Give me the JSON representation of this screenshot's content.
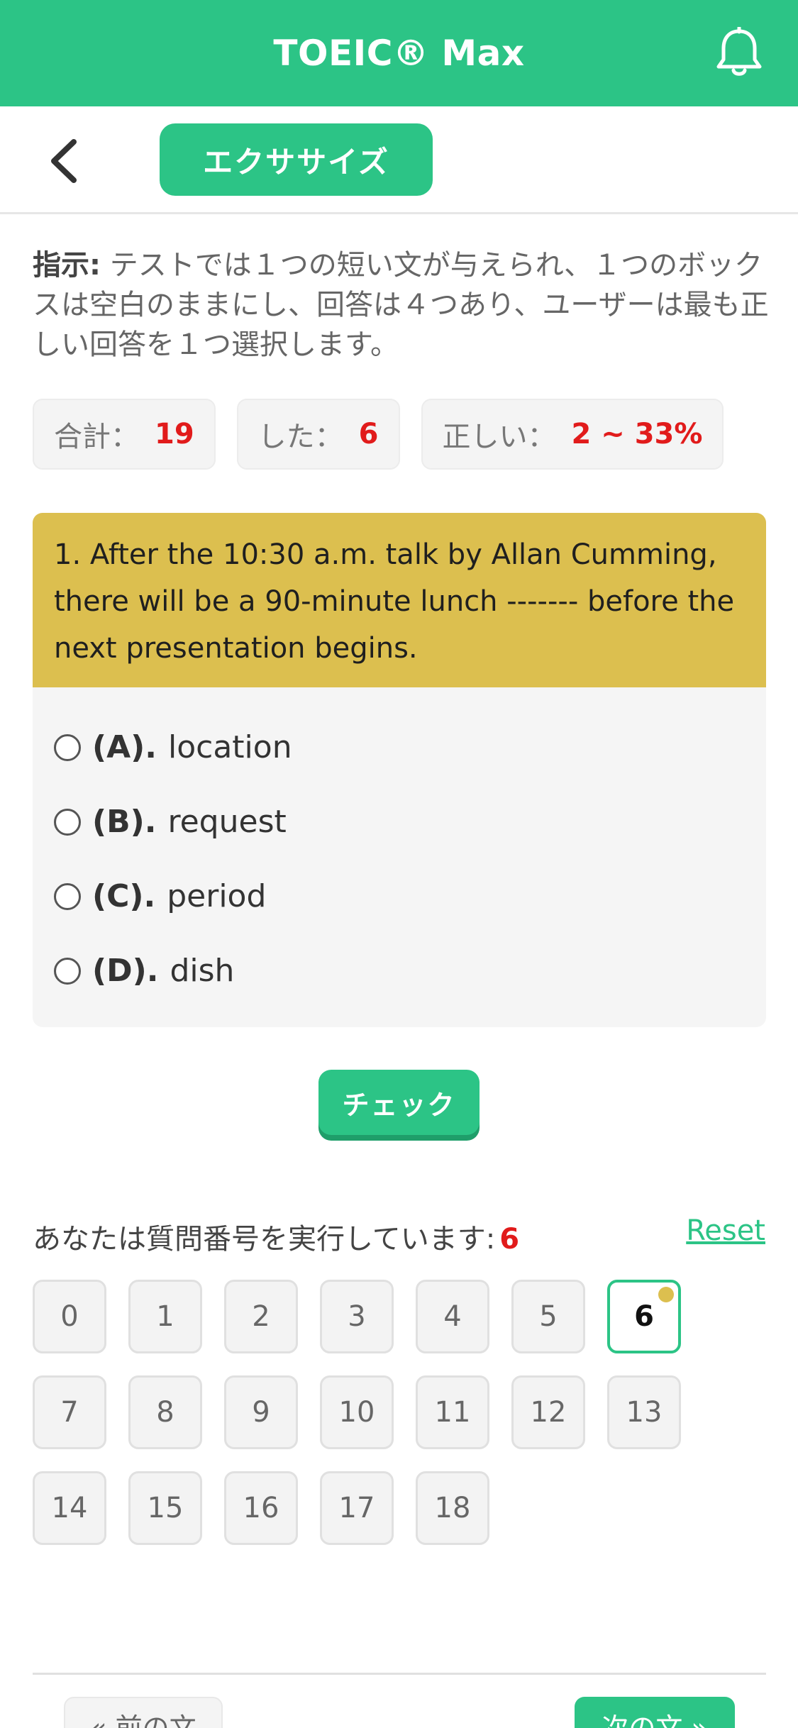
{
  "header": {
    "title": "TOEIC® Max",
    "bell_icon": "bell-icon"
  },
  "subbar": {
    "back_icon": "chevron-left-icon",
    "tab_label": "エクササイズ"
  },
  "instructions": {
    "label": "指示:",
    "text": " テストでは１つの短い文が与えられ、１つのボックスは空白のままにし、回答は４つあり、ユーザーは最も正しい回答を１つ選択します。"
  },
  "stats": [
    {
      "label": "合計：",
      "value": "19"
    },
    {
      "label": "した：",
      "value": "6"
    },
    {
      "label": "正しい：",
      "value": "2 ~ 33%"
    }
  ],
  "question": {
    "text": "1. After the 10:30 a.m. talk by Allan Cumming, there will be a 90-minute lunch ------- before the next presentation begins.",
    "options": [
      {
        "label": "(A).",
        "text": "location"
      },
      {
        "label": "(B).",
        "text": "request"
      },
      {
        "label": "(C).",
        "text": "period"
      },
      {
        "label": "(D).",
        "text": "dish"
      }
    ]
  },
  "check_label": "チェック",
  "progress": {
    "label": "あなたは質問番号を実行しています:",
    "current": "6",
    "reset_label": "Reset"
  },
  "grid": [
    "0",
    "1",
    "2",
    "3",
    "4",
    "5",
    "6",
    "7",
    "8",
    "9",
    "10",
    "11",
    "12",
    "13",
    "14",
    "15",
    "16",
    "17",
    "18"
  ],
  "footer": {
    "prev_label": "« 前の文",
    "next_label": "次の文 »"
  },
  "colors": {
    "accent": "#2cc486",
    "highlight": "#dcbf4f",
    "alert": "#e11b1b"
  }
}
